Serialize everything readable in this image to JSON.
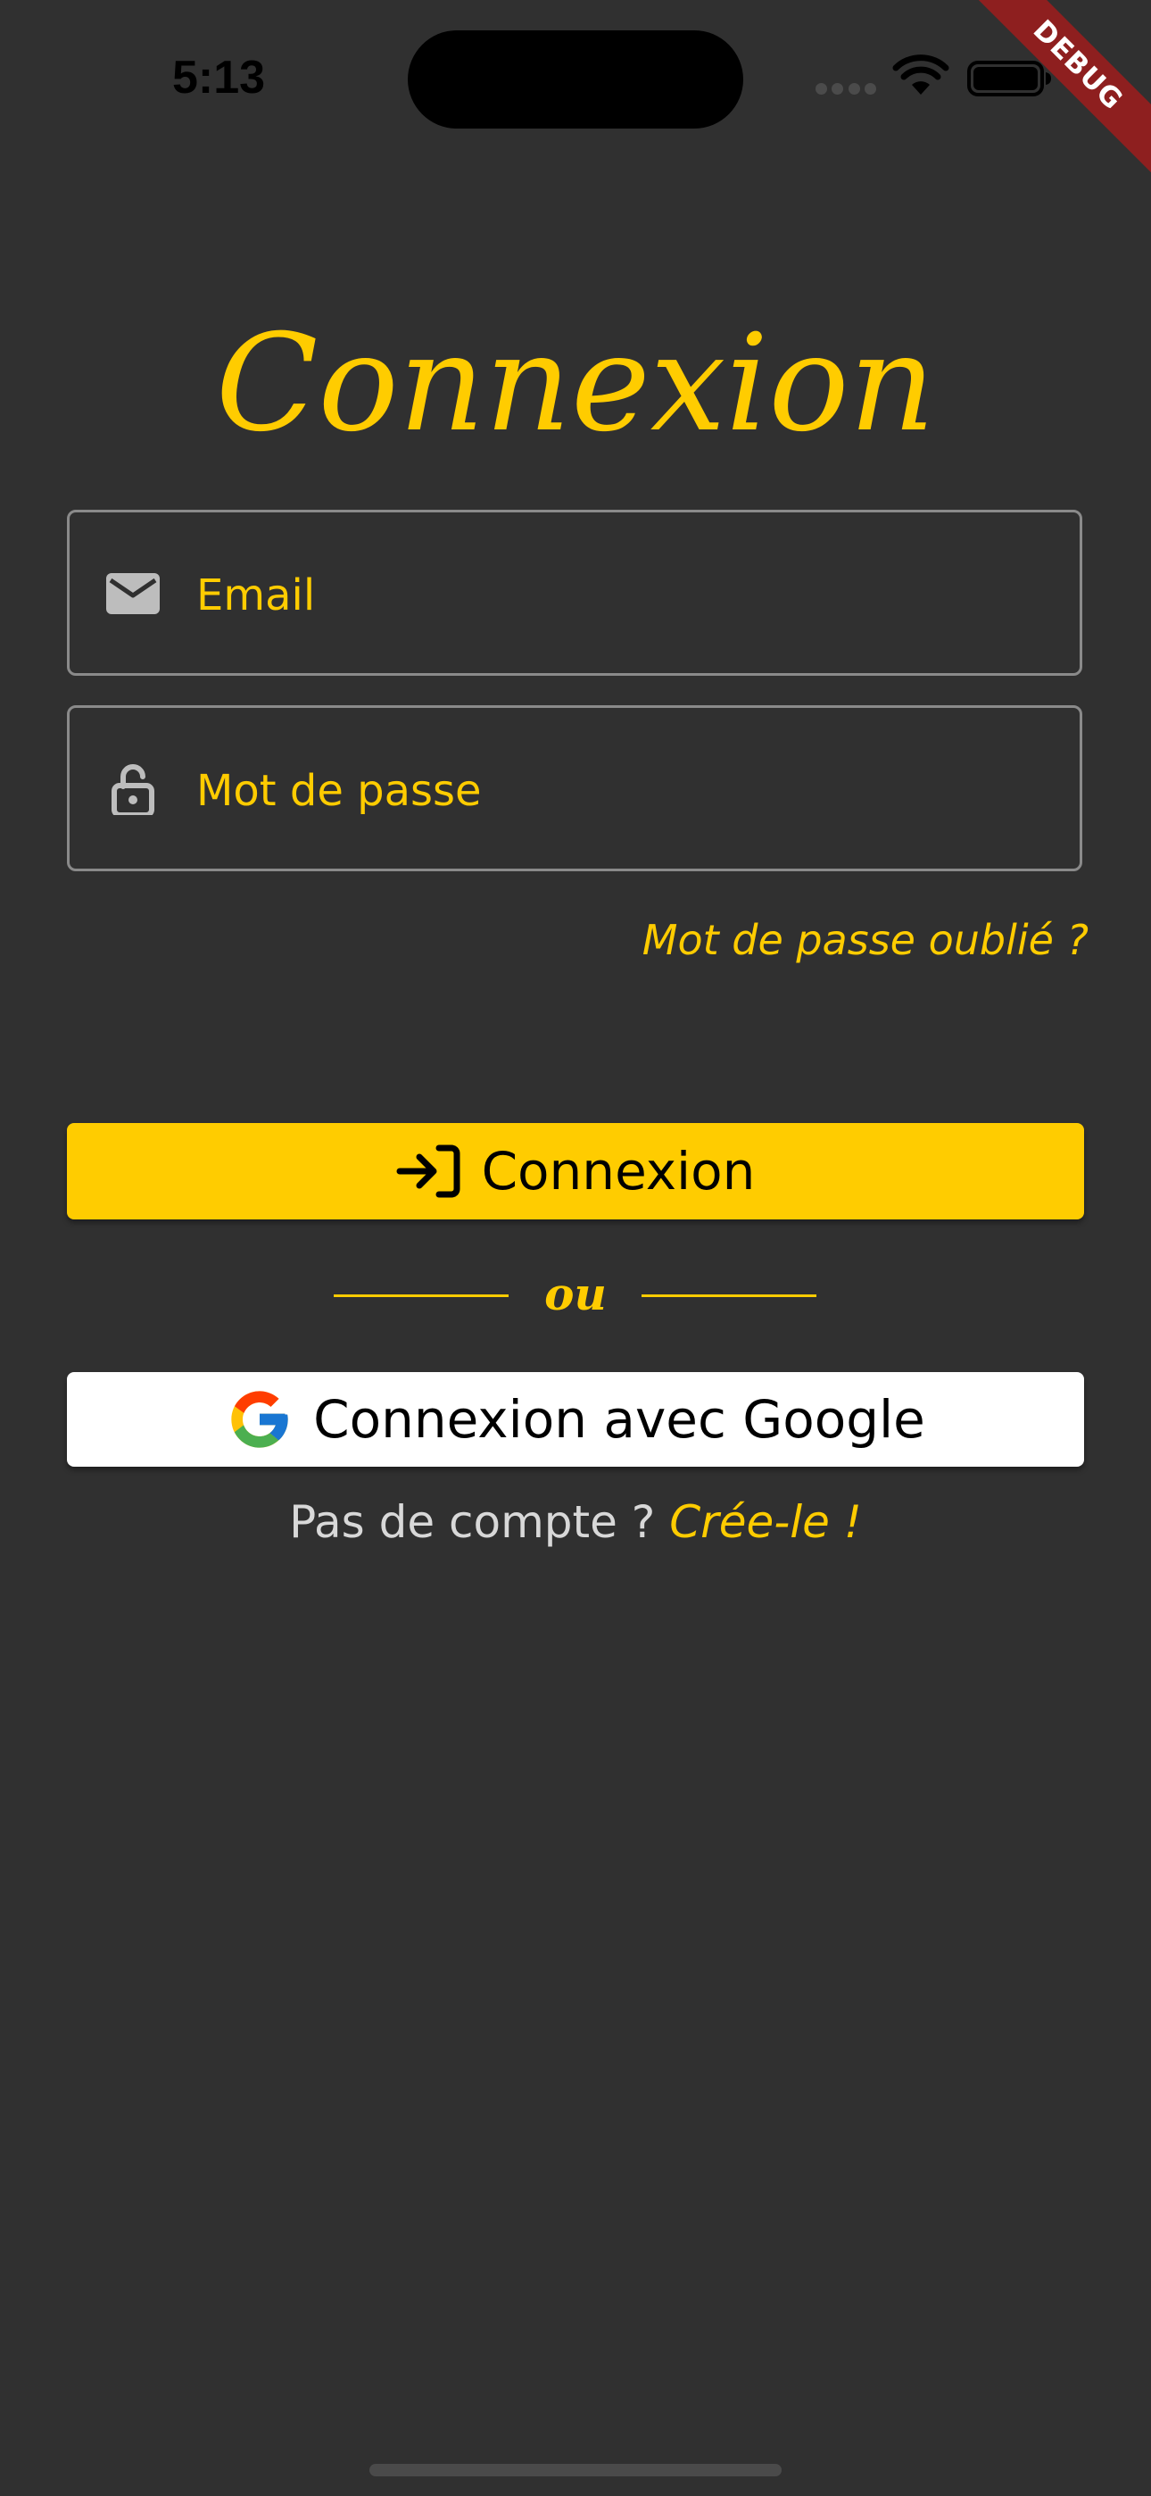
{
  "status_bar": {
    "time": "5:13"
  },
  "debug_banner": "DEBUG",
  "login": {
    "title": "Connexion",
    "email_placeholder": "Email",
    "password_placeholder": "Mot de passe",
    "forgot_password": "Mot de passe oublié ?",
    "submit_label": "Connexion",
    "separator_text": "ou",
    "google_label": "Connexion avec Google",
    "no_account_text": "Pas de compte ?",
    "signup_link": "Crée-le !"
  },
  "colors": {
    "background": "#303030",
    "accent": "#ffcc00",
    "field_border": "#8a8a8a",
    "google_button_bg": "#ffffff",
    "debug_ribbon": "#8e1f1f"
  },
  "icons": {
    "email_field": "mail-icon",
    "password_field": "lock-open-icon",
    "submit": "login-icon",
    "google": "google-logo-icon"
  }
}
